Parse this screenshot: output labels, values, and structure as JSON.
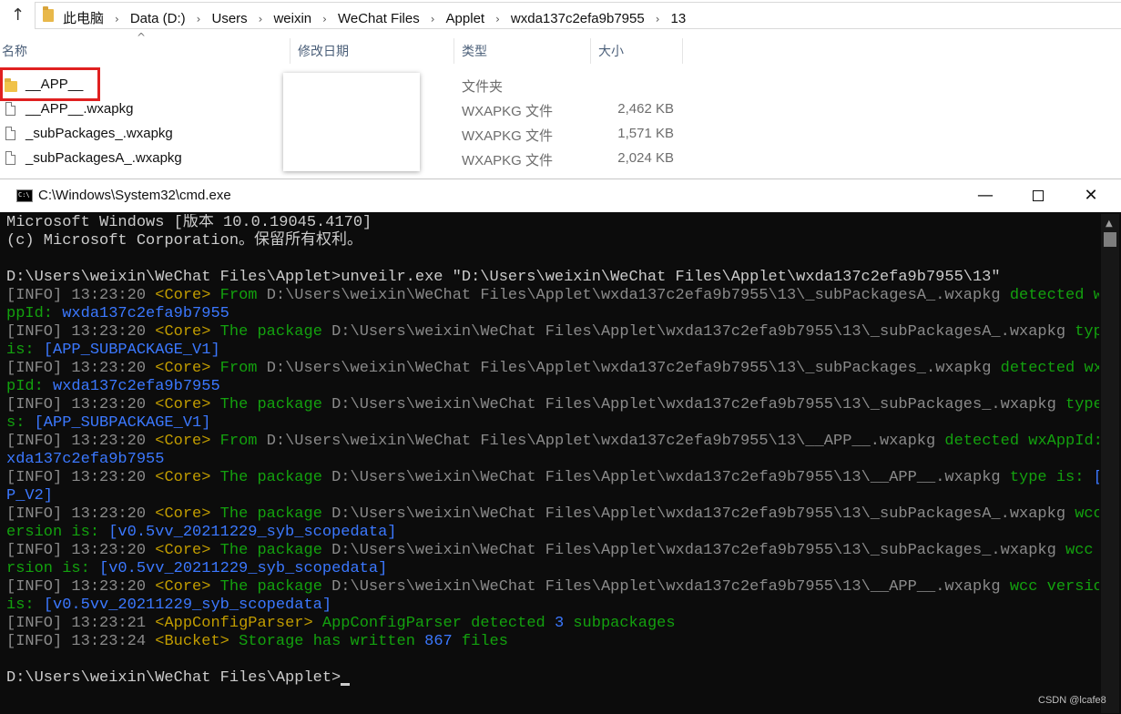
{
  "explorer": {
    "breadcrumbs": [
      "此电脑",
      "Data (D:)",
      "Users",
      "weixin",
      "WeChat Files",
      "Applet",
      "wxda137c2efa9b7955",
      "13"
    ],
    "columns": {
      "name": "名称",
      "modified": "修改日期",
      "type": "类型",
      "size": "大小"
    },
    "files": [
      {
        "name": "__APP__",
        "type": "文件夹",
        "size": "",
        "kind": "folder"
      },
      {
        "name": "__APP__.wxapkg",
        "type": "WXAPKG 文件",
        "size": "2,462 KB",
        "kind": "file"
      },
      {
        "name": "_subPackages_.wxapkg",
        "type": "WXAPKG 文件",
        "size": "1,571 KB",
        "kind": "file"
      },
      {
        "name": "_subPackagesA_.wxapkg",
        "type": "WXAPKG 文件",
        "size": "2,024 KB",
        "kind": "file"
      }
    ],
    "highlight_color": "#e02020"
  },
  "cmd": {
    "title": "C:\\Windows\\System32\\cmd.exe",
    "icon_text": "C:\\",
    "buttons": {
      "minimize": "—",
      "close": "✕"
    },
    "lines": [
      [
        {
          "t": "Microsoft Windows [版本 10.0.19045.4170]",
          "c": ""
        }
      ],
      [
        {
          "t": "(c) Microsoft Corporation。保留所有权利。",
          "c": ""
        }
      ],
      [
        {
          "t": "",
          "c": ""
        }
      ],
      [
        {
          "t": "D:\\Users\\weixin\\WeChat Files\\Applet>unveilr.exe \"D:\\Users\\weixin\\WeChat Files\\Applet\\wxda137c2efa9b7955\\13\"",
          "c": ""
        }
      ],
      [
        {
          "t": "[INFO] ",
          "c": "c-info"
        },
        {
          "t": "13:23:20 ",
          "c": "c-time"
        },
        {
          "t": "<Core> ",
          "c": "c-core"
        },
        {
          "t": "From ",
          "c": "c-msg"
        },
        {
          "t": "D:\\Users\\weixin\\WeChat Files\\Applet\\wxda137c2efa9b7955\\13\\_subPackagesA_.wxapkg ",
          "c": "c-path"
        },
        {
          "t": "detected wxA",
          "c": "c-msg"
        }
      ],
      [
        {
          "t": "ppId: ",
          "c": "c-msg"
        },
        {
          "t": "wxda137c2efa9b7955",
          "c": "c-val"
        }
      ],
      [
        {
          "t": "[INFO] ",
          "c": "c-info"
        },
        {
          "t": "13:23:20 ",
          "c": "c-time"
        },
        {
          "t": "<Core> ",
          "c": "c-core"
        },
        {
          "t": "The package ",
          "c": "c-msg"
        },
        {
          "t": "D:\\Users\\weixin\\WeChat Files\\Applet\\wxda137c2efa9b7955\\13\\_subPackagesA_.wxapkg ",
          "c": "c-path"
        },
        {
          "t": "type",
          "c": "c-msg"
        }
      ],
      [
        {
          "t": "is: ",
          "c": "c-msg"
        },
        {
          "t": "[APP_SUBPACKAGE_V1]",
          "c": "c-val"
        }
      ],
      [
        {
          "t": "[INFO] ",
          "c": "c-info"
        },
        {
          "t": "13:23:20 ",
          "c": "c-time"
        },
        {
          "t": "<Core> ",
          "c": "c-core"
        },
        {
          "t": "From ",
          "c": "c-msg"
        },
        {
          "t": "D:\\Users\\weixin\\WeChat Files\\Applet\\wxda137c2efa9b7955\\13\\_subPackages_.wxapkg ",
          "c": "c-path"
        },
        {
          "t": "detected wxAp",
          "c": "c-msg"
        }
      ],
      [
        {
          "t": "pId: ",
          "c": "c-msg"
        },
        {
          "t": "wxda137c2efa9b7955",
          "c": "c-val"
        }
      ],
      [
        {
          "t": "[INFO] ",
          "c": "c-info"
        },
        {
          "t": "13:23:20 ",
          "c": "c-time"
        },
        {
          "t": "<Core> ",
          "c": "c-core"
        },
        {
          "t": "The package ",
          "c": "c-msg"
        },
        {
          "t": "D:\\Users\\weixin\\WeChat Files\\Applet\\wxda137c2efa9b7955\\13\\_subPackages_.wxapkg ",
          "c": "c-path"
        },
        {
          "t": "type i",
          "c": "c-msg"
        }
      ],
      [
        {
          "t": "s: ",
          "c": "c-msg"
        },
        {
          "t": "[APP_SUBPACKAGE_V1]",
          "c": "c-val"
        }
      ],
      [
        {
          "t": "[INFO] ",
          "c": "c-info"
        },
        {
          "t": "13:23:20 ",
          "c": "c-time"
        },
        {
          "t": "<Core> ",
          "c": "c-core"
        },
        {
          "t": "From ",
          "c": "c-msg"
        },
        {
          "t": "D:\\Users\\weixin\\WeChat Files\\Applet\\wxda137c2efa9b7955\\13\\__APP__.wxapkg ",
          "c": "c-path"
        },
        {
          "t": "detected wxAppId: ",
          "c": "c-msg"
        },
        {
          "t": "w",
          "c": "c-val"
        }
      ],
      [
        {
          "t": "xda137c2efa9b7955",
          "c": "c-val"
        }
      ],
      [
        {
          "t": "[INFO] ",
          "c": "c-info"
        },
        {
          "t": "13:23:20 ",
          "c": "c-time"
        },
        {
          "t": "<Core> ",
          "c": "c-core"
        },
        {
          "t": "The package ",
          "c": "c-msg"
        },
        {
          "t": "D:\\Users\\weixin\\WeChat Files\\Applet\\wxda137c2efa9b7955\\13\\__APP__.wxapkg ",
          "c": "c-path"
        },
        {
          "t": "type is: ",
          "c": "c-msg"
        },
        {
          "t": "[AP",
          "c": "c-val"
        }
      ],
      [
        {
          "t": "P_V2]",
          "c": "c-val"
        }
      ],
      [
        {
          "t": "[INFO] ",
          "c": "c-info"
        },
        {
          "t": "13:23:20 ",
          "c": "c-time"
        },
        {
          "t": "<Core> ",
          "c": "c-core"
        },
        {
          "t": "The package ",
          "c": "c-msg"
        },
        {
          "t": "D:\\Users\\weixin\\WeChat Files\\Applet\\wxda137c2efa9b7955\\13\\_subPackagesA_.wxapkg ",
          "c": "c-path"
        },
        {
          "t": "wcc v",
          "c": "c-msg"
        }
      ],
      [
        {
          "t": "ersion is: ",
          "c": "c-msg"
        },
        {
          "t": "[v0.5vv_20211229_syb_scopedata]",
          "c": "c-val"
        }
      ],
      [
        {
          "t": "[INFO] ",
          "c": "c-info"
        },
        {
          "t": "13:23:20 ",
          "c": "c-time"
        },
        {
          "t": "<Core> ",
          "c": "c-core"
        },
        {
          "t": "The package ",
          "c": "c-msg"
        },
        {
          "t": "D:\\Users\\weixin\\WeChat Files\\Applet\\wxda137c2efa9b7955\\13\\_subPackages_.wxapkg ",
          "c": "c-path"
        },
        {
          "t": "wcc ve",
          "c": "c-msg"
        }
      ],
      [
        {
          "t": "rsion is: ",
          "c": "c-msg"
        },
        {
          "t": "[v0.5vv_20211229_syb_scopedata]",
          "c": "c-val"
        }
      ],
      [
        {
          "t": "[INFO] ",
          "c": "c-info"
        },
        {
          "t": "13:23:20 ",
          "c": "c-time"
        },
        {
          "t": "<Core> ",
          "c": "c-core"
        },
        {
          "t": "The package ",
          "c": "c-msg"
        },
        {
          "t": "D:\\Users\\weixin\\WeChat Files\\Applet\\wxda137c2efa9b7955\\13\\__APP__.wxapkg ",
          "c": "c-path"
        },
        {
          "t": "wcc version",
          "c": "c-msg"
        }
      ],
      [
        {
          "t": "is: ",
          "c": "c-msg"
        },
        {
          "t": "[v0.5vv_20211229_syb_scopedata]",
          "c": "c-val"
        }
      ],
      [
        {
          "t": "[INFO] ",
          "c": "c-info"
        },
        {
          "t": "13:23:21 ",
          "c": "c-time"
        },
        {
          "t": "<AppConfigParser> ",
          "c": "c-core"
        },
        {
          "t": "AppConfigParser detected ",
          "c": "c-msg"
        },
        {
          "t": "3",
          "c": "c-val"
        },
        {
          "t": " subpackages",
          "c": "c-msg"
        }
      ],
      [
        {
          "t": "[INFO] ",
          "c": "c-info"
        },
        {
          "t": "13:23:24 ",
          "c": "c-time"
        },
        {
          "t": "<Bucket> ",
          "c": "c-core"
        },
        {
          "t": "Storage has written ",
          "c": "c-msg"
        },
        {
          "t": "867",
          "c": "c-val"
        },
        {
          "t": " files",
          "c": "c-msg"
        }
      ],
      [
        {
          "t": "",
          "c": ""
        }
      ],
      [
        {
          "t": "D:\\Users\\weixin\\WeChat Files\\Applet>",
          "c": ""
        }
      ]
    ],
    "colors": {
      "background": "#0c0c0c",
      "text": "#cccccc",
      "info": "#8a8a8a",
      "tag": "#c19c00",
      "message": "#13a10e",
      "value": "#3b78ff"
    }
  },
  "watermark": "CSDN @lcafe8"
}
